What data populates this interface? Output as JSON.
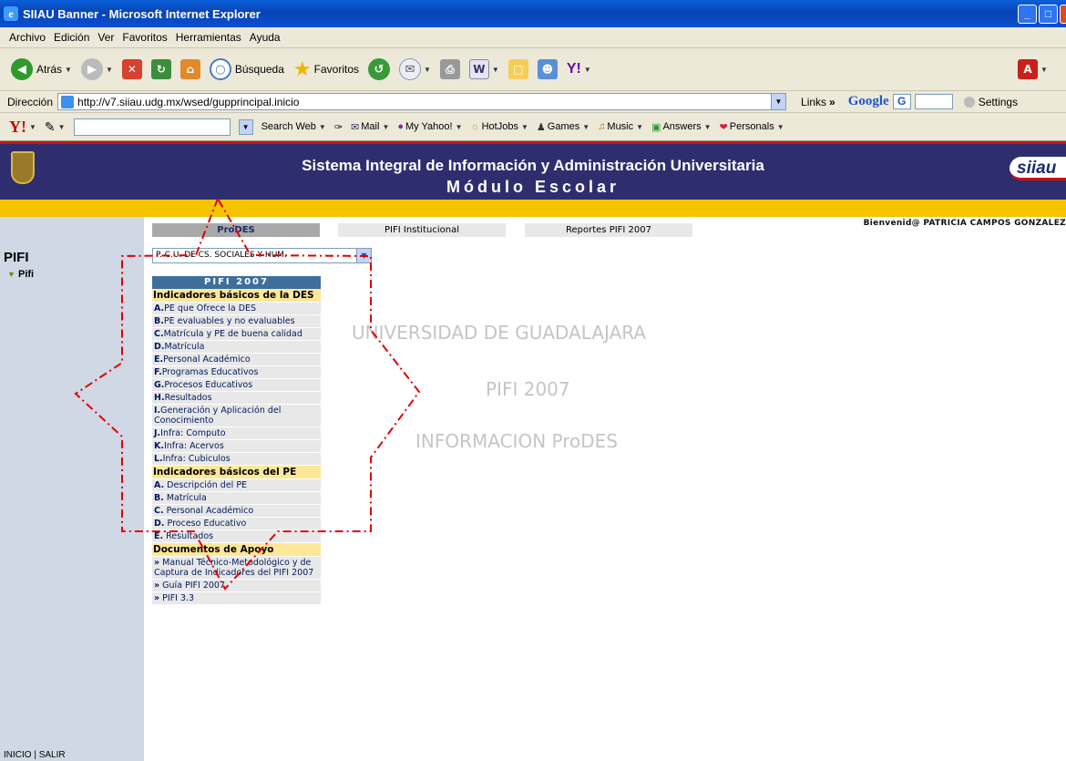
{
  "window": {
    "title": "SIIAU Banner - Microsoft Internet Explorer",
    "min": "_",
    "max": "□",
    "close": "X"
  },
  "menubar": [
    "Archivo",
    "Edición",
    "Ver",
    "Favoritos",
    "Herramientas",
    "Ayuda"
  ],
  "toolbar": {
    "back": "Atrás",
    "search": "Búsqueda",
    "favorites": "Favoritos"
  },
  "address": {
    "label": "Dirección",
    "url": "http://v7.siiau.udg.mx/wsed/gupprincipal.inicio",
    "links": "Links",
    "google": "Google",
    "settings": "Settings"
  },
  "yahoobar": {
    "logo": "Y!",
    "search_web": "Search Web",
    "mail": "Mail",
    "my_yahoo": "My Yahoo!",
    "hotjobs": "HotJobs",
    "games": "Games",
    "music": "Music",
    "answers": "Answers",
    "personals": "Personals"
  },
  "banner": {
    "line1": "Sistema Integral de Información y Administración Universitaria",
    "line2": "Módulo Escolar",
    "logo": "siiau"
  },
  "greeting": "Bienvenid@ PATRICIA CAMPOS GONZALEZ",
  "sidebar": {
    "title": "PIFI",
    "item": "Pifi",
    "bottom": "INICIO | SALIR"
  },
  "tabs": [
    "ProDES",
    "PIFI Institucional",
    "Reportes PIFI 2007"
  ],
  "select": {
    "value": "P. C.U. DE CS. SOCIALES Y HUM."
  },
  "menu": {
    "header": "PIFI 2007",
    "sections": [
      {
        "title": "Indicadores básicos de la DES",
        "items": [
          {
            "k": "A.",
            "t": "PE que Ofrece la DES"
          },
          {
            "k": "B.",
            "t": "PE evaluables y no evaluables"
          },
          {
            "k": "C.",
            "t": "Matrícula y PE de buena calidad"
          },
          {
            "k": "D.",
            "t": "Matrícula"
          },
          {
            "k": "E.",
            "t": "Personal Académico"
          },
          {
            "k": "F.",
            "t": "Programas Educativos"
          },
          {
            "k": "G.",
            "t": "Procesos Educativos"
          },
          {
            "k": "H.",
            "t": "Resultados"
          },
          {
            "k": "I.",
            "t": "Generación y Aplicación del Conocimiento"
          },
          {
            "k": "J.",
            "t": "Infra: Computo"
          },
          {
            "k": "K.",
            "t": "Infra: Acervos"
          },
          {
            "k": "L.",
            "t": "Infra: Cubiculos"
          }
        ]
      },
      {
        "title": "Indicadores básicos del PE",
        "items": [
          {
            "k": "A.",
            "t": " Descripción del PE"
          },
          {
            "k": "B.",
            "t": " Matrícula"
          },
          {
            "k": "C.",
            "t": " Personal Académico"
          },
          {
            "k": "D.",
            "t": " Proceso Educativo"
          },
          {
            "k": "E.",
            "t": " Resultados"
          }
        ]
      },
      {
        "title": "Documentos de Apoyo",
        "items": [
          {
            "k": "»",
            "t": " Manual Técnico-Metodológico y de Captura de Indicadores del PIFI 2007"
          },
          {
            "k": "»",
            "t": " Guía PIFI 2007"
          },
          {
            "k": "»",
            "t": " PIFI 3.3"
          }
        ]
      }
    ]
  },
  "watermark": [
    "UNIVERSIDAD DE GUADALAJARA",
    "PIFI 2007",
    "INFORMACION ProDES"
  ],
  "annotation_color": "#e00000"
}
